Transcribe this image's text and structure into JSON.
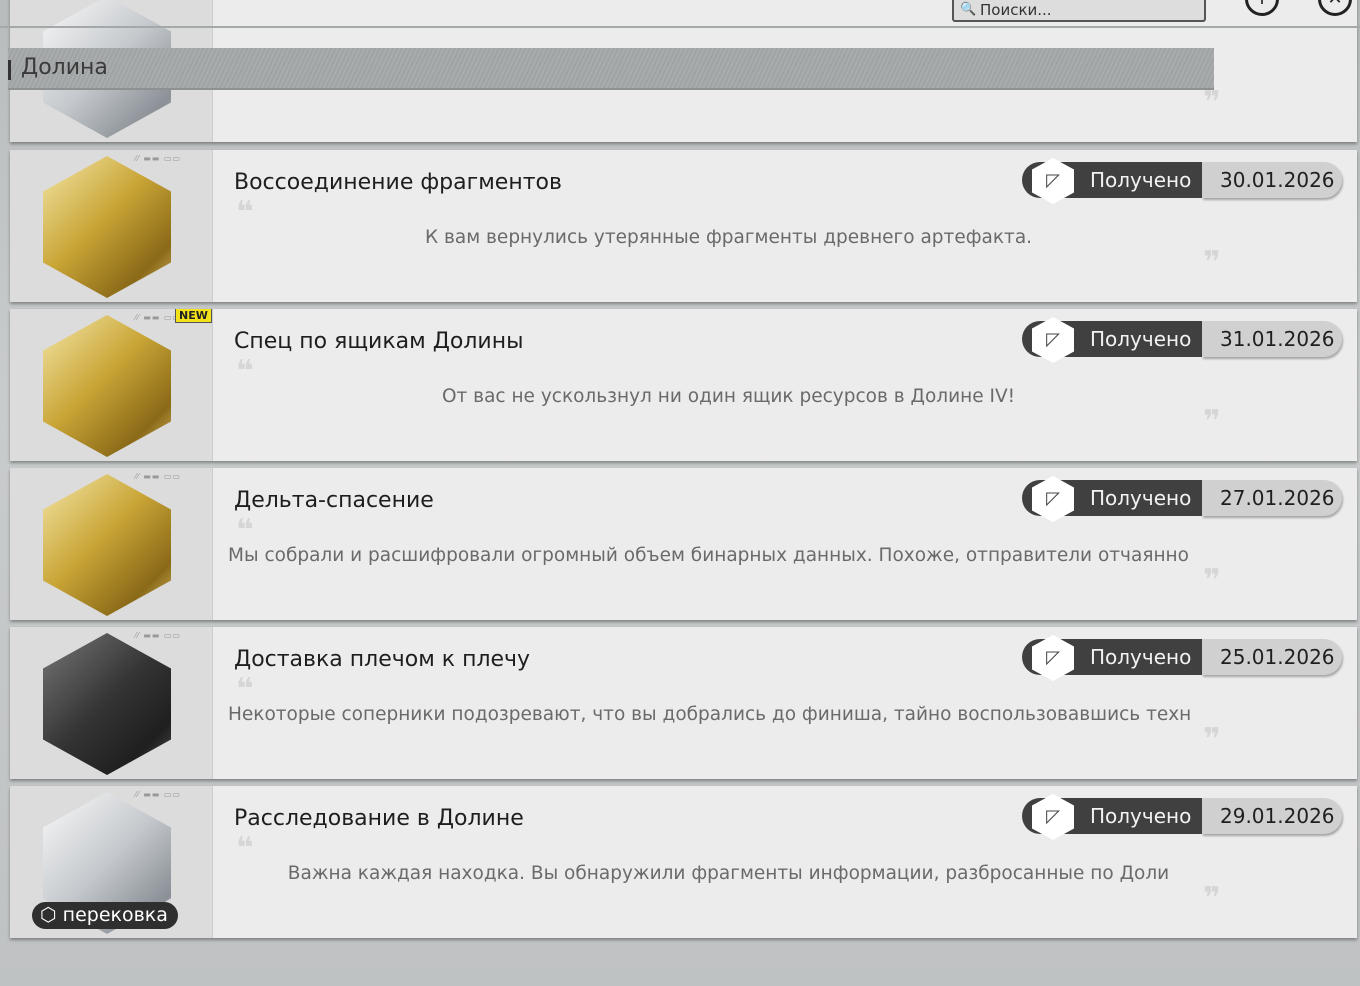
{
  "header": {
    "search_placeholder": "Поиски...",
    "info_icon": "info-icon",
    "close_icon": "close-icon"
  },
  "section": {
    "title": "Долина"
  },
  "status_label": "Получено",
  "reforge_label": "перековка",
  "new_label": "NEW",
  "achievements": [
    {
      "title": "Воссоединение фрагментов",
      "description": "К вам вернулись утерянные фрагменты древнего артефакта.",
      "status": "Получено",
      "date": "30.01.2026",
      "tier": "gold"
    },
    {
      "title": "Спец по ящикам Долины",
      "description": "От вас не ускользнул ни один ящик ресурсов в Долине IV!",
      "status": "Получено",
      "date": "31.01.2026",
      "tier": "gold",
      "new": "NEW"
    },
    {
      "title": "Дельта-спасение",
      "description": "Мы собрали и расшифровали огромный объем бинарных данных. Похоже, отправители отчаянно",
      "status": "Получено",
      "date": "27.01.2026",
      "tier": "gold"
    },
    {
      "title": "Доставка плечом к плечу",
      "description": "Некоторые соперники подозревают, что вы добрались до финиша, тайно воспользовавшись техн",
      "status": "Получено",
      "date": "25.01.2026",
      "tier": "dark"
    },
    {
      "title": "Расследование в Долине",
      "description": "Важна каждая находка. Вы обнаружили фрагменты информации, разбросанные по Доли",
      "status": "Получено",
      "date": "29.01.2026",
      "tier": "silver"
    }
  ]
}
